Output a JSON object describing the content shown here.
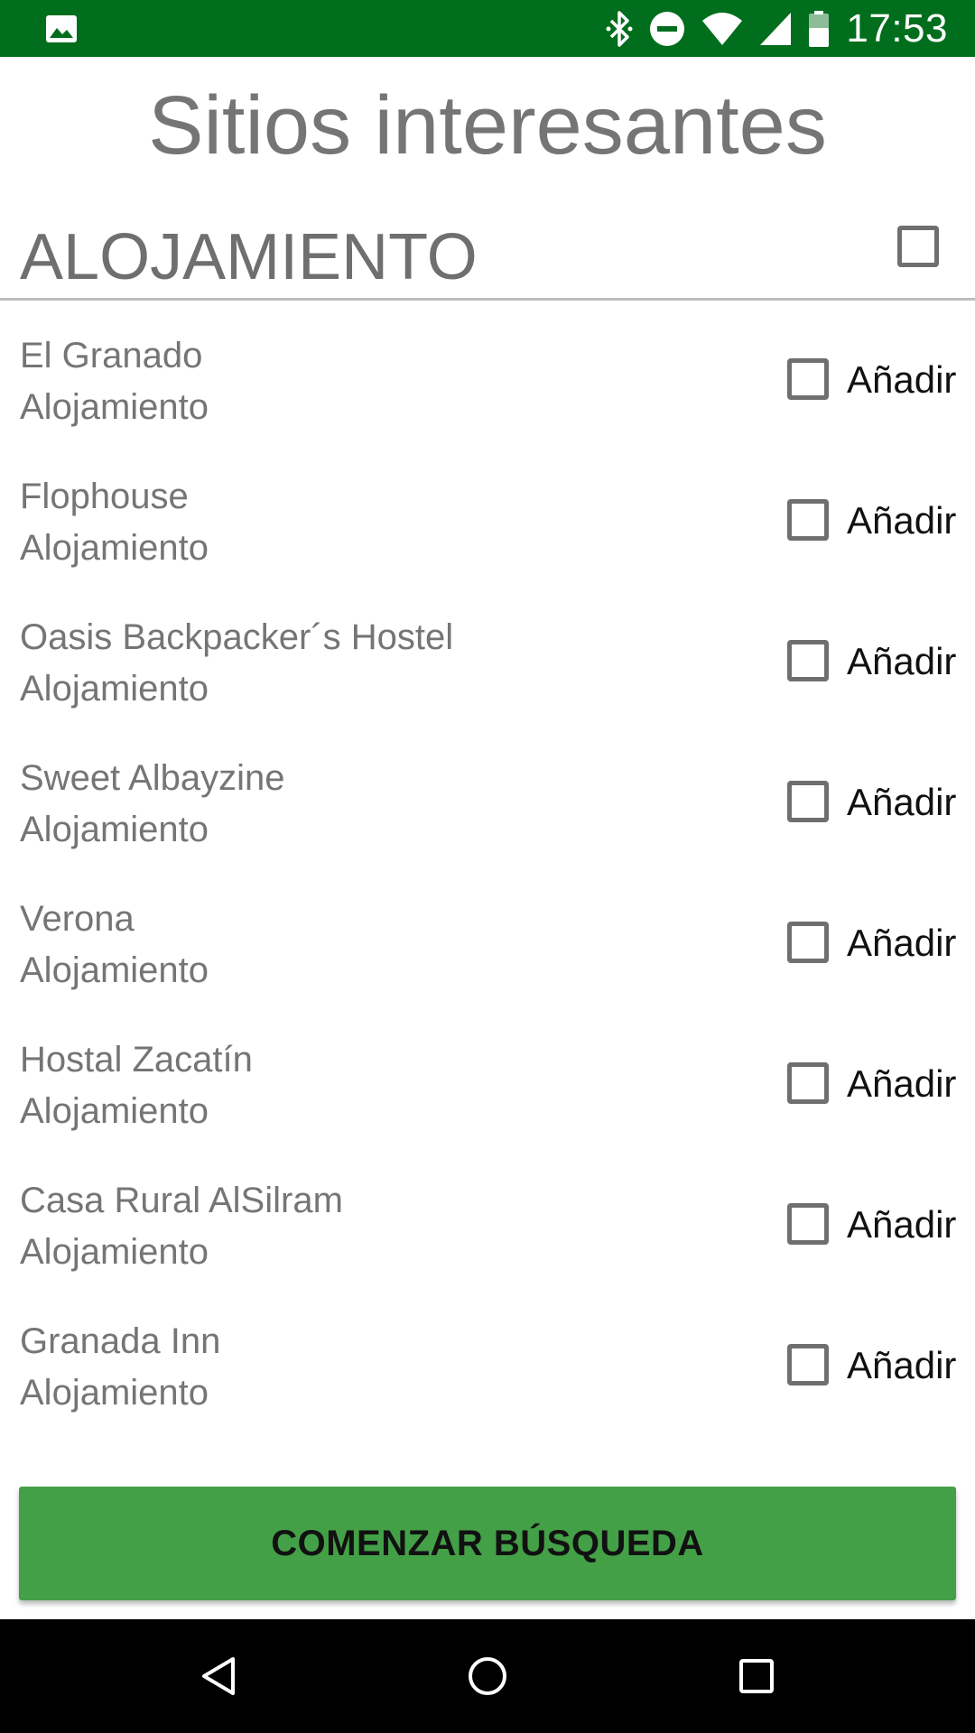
{
  "status_bar": {
    "time": "17:53",
    "icons": [
      "image-icon",
      "bluetooth-icon",
      "do-not-disturb-icon",
      "wifi-icon",
      "signal-icon",
      "battery-icon"
    ]
  },
  "page": {
    "title": "Sitios interesantes"
  },
  "section": {
    "title": "ALOJAMIENTO",
    "select_all_checked": false
  },
  "list": {
    "add_label": "Añadir",
    "items": [
      {
        "name": "El Granado",
        "type": "Alojamiento",
        "checked": false
      },
      {
        "name": "Flophouse",
        "type": "Alojamiento",
        "checked": false
      },
      {
        "name": "Oasis Backpacker´s Hostel",
        "type": "Alojamiento",
        "checked": false
      },
      {
        "name": "Sweet Albayzine",
        "type": "Alojamiento",
        "checked": false
      },
      {
        "name": "Verona",
        "type": "Alojamiento",
        "checked": false
      },
      {
        "name": "Hostal Zacatín",
        "type": "Alojamiento",
        "checked": false
      },
      {
        "name": "Casa Rural AlSilram",
        "type": "Alojamiento",
        "checked": false
      },
      {
        "name": "Granada Inn",
        "type": "Alojamiento",
        "checked": false
      }
    ]
  },
  "actions": {
    "search_label": "COMENZAR BÚSQUEDA"
  },
  "colors": {
    "status_bar": "#006e1c",
    "button": "#43a047",
    "text": "#757575"
  },
  "nav_bar": {
    "icons": [
      "back-icon",
      "home-icon",
      "recents-icon"
    ]
  }
}
